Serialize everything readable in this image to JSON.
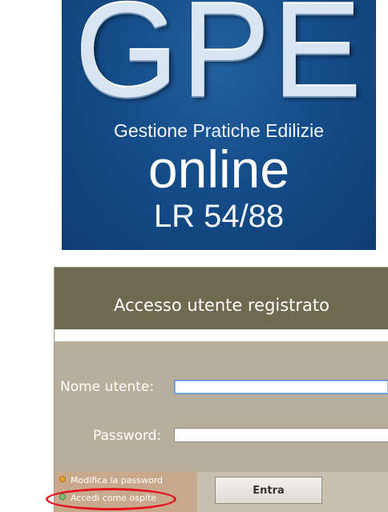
{
  "logo": {
    "acronym": "GPE",
    "subtitle": "Gestione Pratiche Edilizie",
    "online": "online",
    "law": "LR 54/88",
    "background_color": "#154d89"
  },
  "login": {
    "title": "Accesso utente registrato",
    "username_label": "Nome utente:",
    "username_value": "",
    "password_label": "Password:",
    "password_value": "",
    "links": [
      {
        "label": "Modifica la password",
        "bullet_color": "#e8a030"
      },
      {
        "label": "Accedi come ospite",
        "bullet_color": "#7ec27a"
      }
    ],
    "submit_label": "Entra",
    "colors": {
      "header": "#6e6a4f",
      "body": "#b7ae9b",
      "footer_left": "#c9a98d",
      "footer_right": "#c8c0ad"
    }
  },
  "annotation": {
    "shape": "ellipse",
    "color": "#e3141c",
    "highlights": "Accedi come ospite"
  }
}
